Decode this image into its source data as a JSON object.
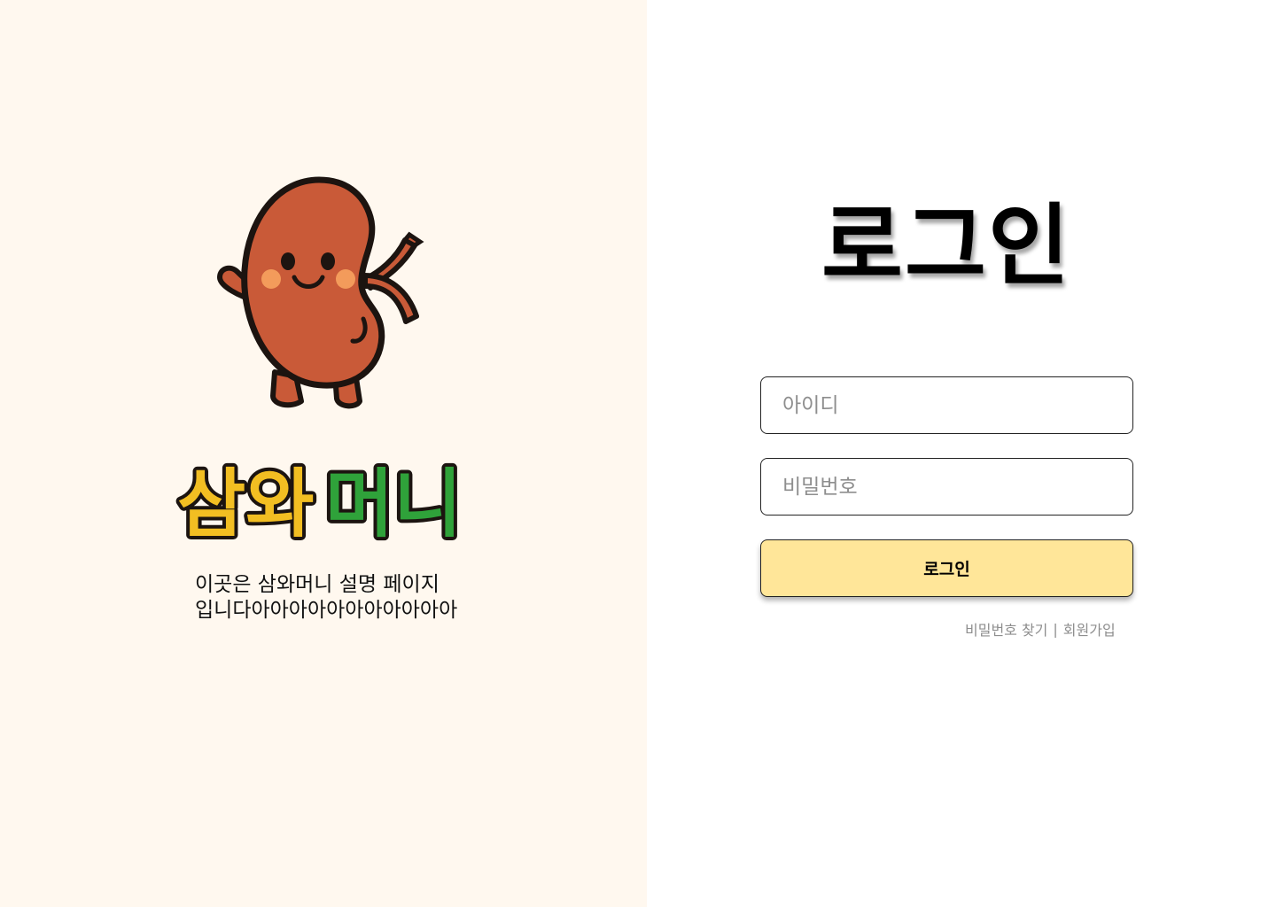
{
  "brand": {
    "logo_text_part1": "삼와",
    "logo_text_part2": "머니",
    "description_line1": "이곳은 삼와머니 설명 페이지",
    "description_line2": "입니다아아아아아아아아아아아",
    "mascot_icon": "kidney-mascot-icon"
  },
  "login": {
    "title": "로그인",
    "id_placeholder": "아이디",
    "password_placeholder": "비밀번호",
    "button_label": "로그인",
    "find_password_label": "비밀번호 찾기",
    "separator": "|",
    "signup_label": "회원가입"
  },
  "colors": {
    "left_background": "#fff8ef",
    "button_background": "#ffe699",
    "logo_yellow": "#f2be22",
    "logo_green": "#2fa23a",
    "mascot_body": "#c95a38",
    "mascot_cheek": "#f39b5b"
  }
}
